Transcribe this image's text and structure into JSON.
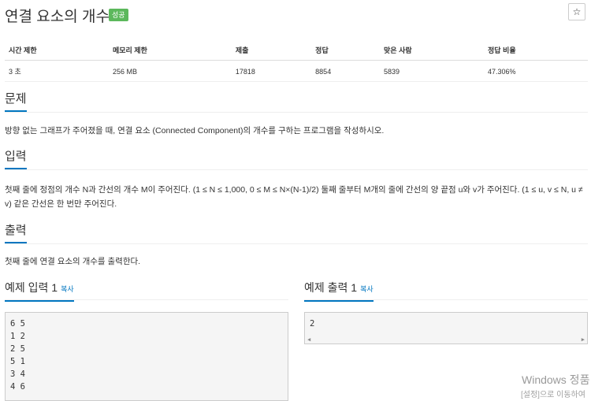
{
  "problem": {
    "title": "연결 요소의 개수",
    "result_badge": "성공",
    "star": "☆"
  },
  "info_table": {
    "headers": [
      "시간 제한",
      "메모리 제한",
      "제출",
      "정답",
      "맞은 사람",
      "정답 비율"
    ],
    "values": [
      "3 초",
      "256 MB",
      "17818",
      "8854",
      "5839",
      "47.306%"
    ]
  },
  "sections": {
    "description": {
      "title": "문제",
      "text": "방향 없는 그래프가 주어졌을 때, 연결 요소 (Connected Component)의 개수를 구하는 프로그램을 작성하시오."
    },
    "input": {
      "title": "입력",
      "text": "첫째 줄에 정점의 개수 N과 간선의 개수 M이 주어진다. (1 ≤ N ≤ 1,000, 0 ≤ M ≤ N×(N-1)/2) 둘째 줄부터 M개의 줄에 간선의 양 끝점 u와 v가 주어진다. (1 ≤ u, v ≤ N, u ≠ v) 같은 간선은 한 번만 주어진다."
    },
    "output": {
      "title": "출력",
      "text": "첫째 줄에 연결 요소의 개수를 출력한다."
    }
  },
  "samples": {
    "input": {
      "title": "예제 입력 1",
      "copy_label": "복사",
      "lines": [
        "6 5",
        "1 2",
        "2 5",
        "5 1",
        "3 4",
        "4 6"
      ]
    },
    "output": {
      "title": "예제 출력 1",
      "copy_label": "복사",
      "lines": [
        "2"
      ]
    }
  },
  "watermark": {
    "line1": "Windows 정품",
    "line2": "[설정]으로 이동하여"
  }
}
